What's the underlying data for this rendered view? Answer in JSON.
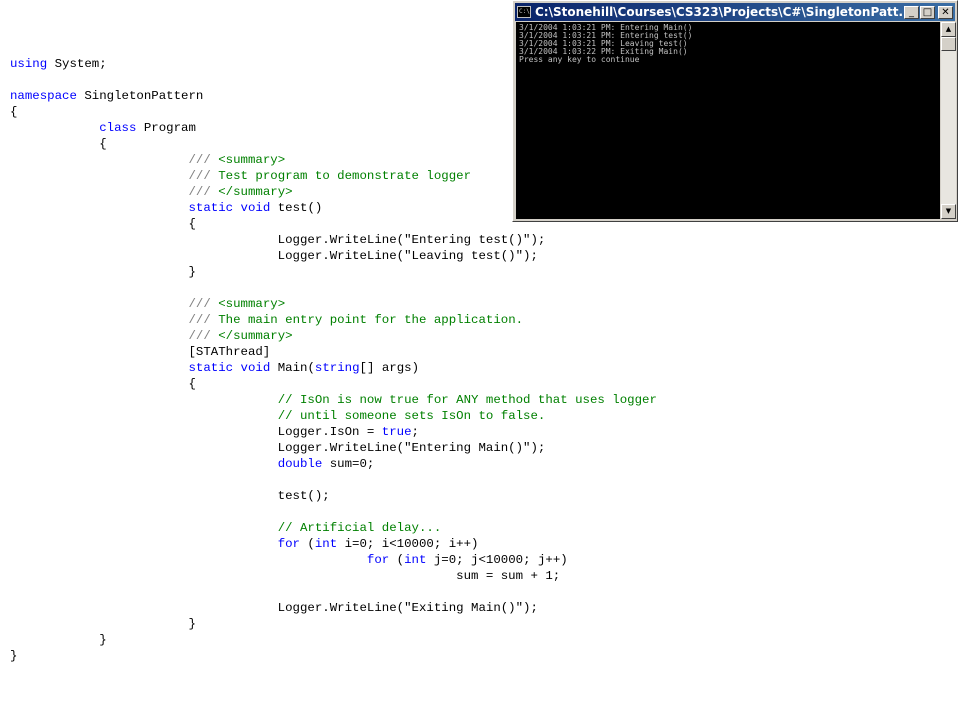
{
  "colors": {
    "keyword": "#0000ff",
    "comment": "#008000",
    "doc": "#808080"
  },
  "code_lines": [
    [
      {
        "t": "using",
        "k": "k"
      },
      {
        "t": " System;"
      }
    ],
    [],
    [
      {
        "t": "namespace",
        "k": "k"
      },
      {
        "t": " SingletonPattern"
      }
    ],
    [
      {
        "t": "{"
      }
    ],
    [
      {
        "t": "            "
      },
      {
        "t": "class",
        "k": "k"
      },
      {
        "t": " Program"
      }
    ],
    [
      {
        "t": "            {"
      }
    ],
    [
      {
        "t": "                        "
      },
      {
        "t": "///",
        "k": "d"
      },
      {
        "t": " <summary>",
        "k": "c"
      }
    ],
    [
      {
        "t": "                        "
      },
      {
        "t": "///",
        "k": "d"
      },
      {
        "t": " Test program to demonstrate logger",
        "k": "c"
      }
    ],
    [
      {
        "t": "                        "
      },
      {
        "t": "///",
        "k": "d"
      },
      {
        "t": " </summary>",
        "k": "c"
      }
    ],
    [
      {
        "t": "                        "
      },
      {
        "t": "static",
        "k": "k"
      },
      {
        "t": " "
      },
      {
        "t": "void",
        "k": "k"
      },
      {
        "t": " test()"
      }
    ],
    [
      {
        "t": "                        {"
      }
    ],
    [
      {
        "t": "                                    Logger.WriteLine(\"Entering test()\");"
      }
    ],
    [
      {
        "t": "                                    Logger.WriteLine(\"Leaving test()\");"
      }
    ],
    [
      {
        "t": "                        }"
      }
    ],
    [],
    [
      {
        "t": "                        "
      },
      {
        "t": "///",
        "k": "d"
      },
      {
        "t": " <summary>",
        "k": "c"
      }
    ],
    [
      {
        "t": "                        "
      },
      {
        "t": "///",
        "k": "d"
      },
      {
        "t": " The main entry point for the application.",
        "k": "c"
      }
    ],
    [
      {
        "t": "                        "
      },
      {
        "t": "///",
        "k": "d"
      },
      {
        "t": " </summary>",
        "k": "c"
      }
    ],
    [
      {
        "t": "                        [STAThread]"
      }
    ],
    [
      {
        "t": "                        "
      },
      {
        "t": "static",
        "k": "k"
      },
      {
        "t": " "
      },
      {
        "t": "void",
        "k": "k"
      },
      {
        "t": " Main("
      },
      {
        "t": "string",
        "k": "k"
      },
      {
        "t": "[] args)"
      }
    ],
    [
      {
        "t": "                        {"
      }
    ],
    [
      {
        "t": "                                    "
      },
      {
        "t": "// IsOn is now true for ANY method that uses logger",
        "k": "c"
      }
    ],
    [
      {
        "t": "                                    "
      },
      {
        "t": "// until someone sets IsOn to false.",
        "k": "c"
      }
    ],
    [
      {
        "t": "                                    Logger.IsOn = "
      },
      {
        "t": "true",
        "k": "k"
      },
      {
        "t": ";"
      }
    ],
    [
      {
        "t": "                                    Logger.WriteLine(\"Entering Main()\");"
      }
    ],
    [
      {
        "t": "                                    "
      },
      {
        "t": "double",
        "k": "k"
      },
      {
        "t": " sum=0;"
      }
    ],
    [],
    [
      {
        "t": "                                    test();"
      }
    ],
    [],
    [
      {
        "t": "                                    "
      },
      {
        "t": "// Artificial delay...",
        "k": "c"
      }
    ],
    [
      {
        "t": "                                    "
      },
      {
        "t": "for",
        "k": "k"
      },
      {
        "t": " ("
      },
      {
        "t": "int",
        "k": "k"
      },
      {
        "t": " i=0; i<10000; i++)"
      }
    ],
    [
      {
        "t": "                                                "
      },
      {
        "t": "for",
        "k": "k"
      },
      {
        "t": " ("
      },
      {
        "t": "int",
        "k": "k"
      },
      {
        "t": " j=0; j<10000; j++)"
      }
    ],
    [
      {
        "t": "                                                            sum = sum + 1;"
      }
    ],
    [],
    [
      {
        "t": "                                    Logger.WriteLine(\"Exiting Main()\");"
      }
    ],
    [
      {
        "t": "                        }"
      }
    ],
    [
      {
        "t": "            }"
      }
    ],
    [
      {
        "t": "}"
      }
    ]
  ],
  "console": {
    "title": "C:\\Stonehill\\Courses\\CS323\\Projects\\C#\\SingletonPatt...",
    "icon_label": "C:\\",
    "buttons": {
      "minimize": "_",
      "maximize": "□",
      "close": "✕"
    },
    "scroll_up": "▲",
    "scroll_down": "▼",
    "lines": [
      "3/1/2004 1:03:21 PM: Entering Main()",
      "3/1/2004 1:03:21 PM: Entering test()",
      "3/1/2004 1:03:21 PM: Leaving test()",
      "3/1/2004 1:03:22 PM: Exiting Main()",
      "Press any key to continue"
    ]
  }
}
